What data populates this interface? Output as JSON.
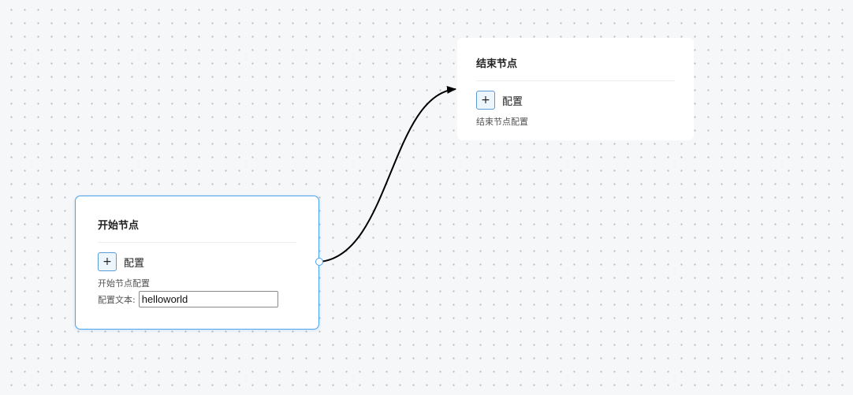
{
  "canvas": {
    "background": "#f6f7f9",
    "grid": "dotted"
  },
  "nodes": {
    "start": {
      "title": "开始节点",
      "add_icon": "+",
      "config_label": "配置",
      "description": "开始节点配置",
      "field_label": "配置文本:",
      "field_value": "helloworld",
      "accent_color": "#4aa3ee"
    },
    "end": {
      "title": "结束节点",
      "add_icon": "+",
      "config_label": "配置",
      "description": "结束节点配置"
    }
  },
  "edges": [
    {
      "from": "开始节点",
      "to": "结束节点",
      "arrow": "arrow-head-icon"
    }
  ]
}
